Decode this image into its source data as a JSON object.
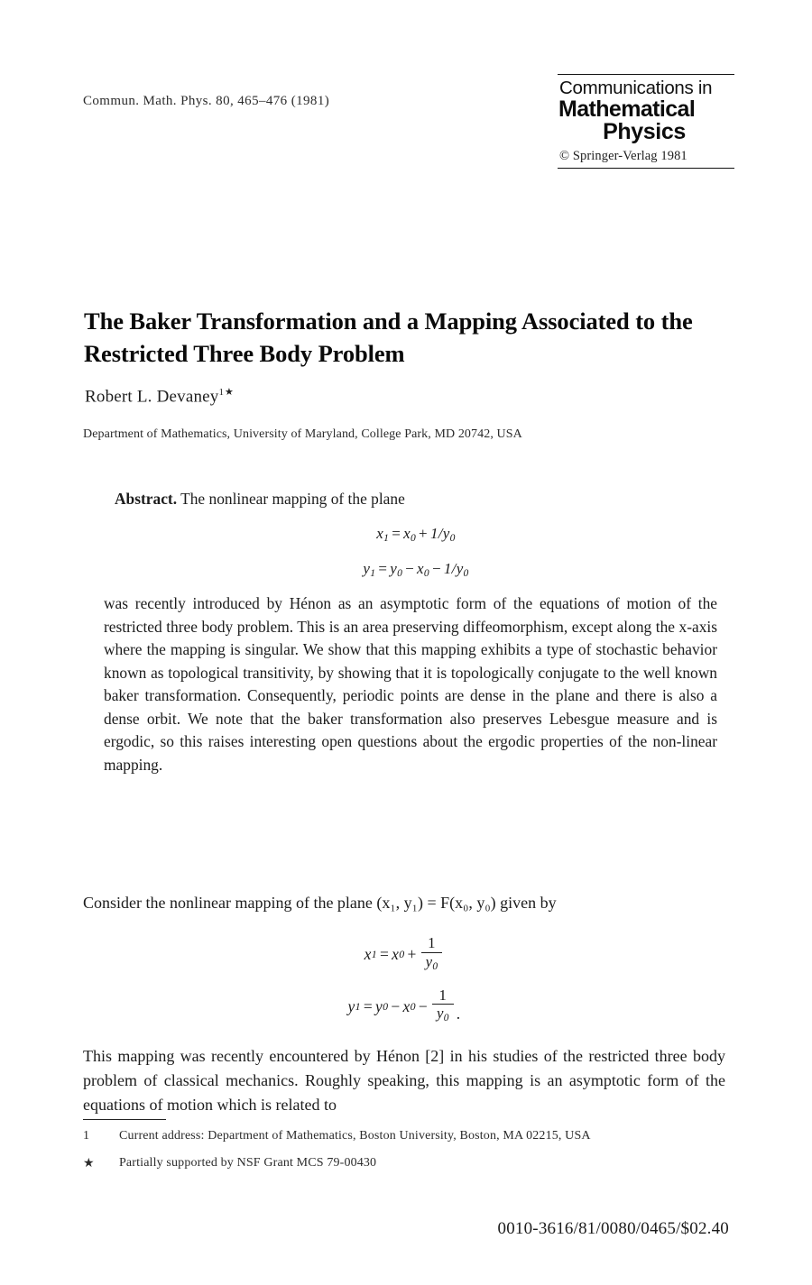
{
  "header": {
    "journal_reference": "Commun. Math. Phys. 80, 465–476 (1981)",
    "masthead": {
      "line1": "Communications in",
      "line2": "Mathematical",
      "line3": "Physics",
      "copyright": "© Springer-Verlag 1981"
    }
  },
  "article": {
    "title": "The Baker Transformation and a Mapping Associated to the Restricted Three Body Problem",
    "author": "Robert L. Devaney",
    "author_markers": "1★",
    "affiliation": "Department of Mathematics, University of Maryland, College Park, MD 20742, USA"
  },
  "abstract": {
    "label": "Abstract.",
    "intro": "The nonlinear mapping of the plane",
    "equations": [
      {
        "lhs": "x",
        "lhs_sub": "1",
        "rhs": "x₀ + 1/y₀"
      },
      {
        "lhs": "y",
        "lhs_sub": "1",
        "rhs": "y₀ − x₀ − 1/y₀"
      }
    ],
    "body": "was recently introduced by Hénon as an asymptotic form of the equations of motion of the restricted three body problem. This is an area preserving diffeomorphism, except along the x-axis where the mapping is singular. We show that this mapping exhibits a type of stochastic behavior known as topological transitivity, by showing that it is topologically conjugate to the well known baker transformation. Consequently, periodic points are dense in the plane and there is also a dense orbit. We note that the baker transformation also preserves Lebesgue measure and is ergodic, so this raises interesting open questions about the ergodic properties of the non-linear mapping."
  },
  "body": {
    "paragraph_1": "Consider the nonlinear mapping of the plane (x₁, y₁) = F(x₀, y₀) given by",
    "paragraph_2": "This mapping was recently encountered by Hénon [2] in his studies of the restricted three body problem of classical mechanics. Roughly speaking, this mapping is an asymptotic form of the equations of motion which is related to"
  },
  "footnotes": [
    {
      "marker": "1",
      "text": "Current address: Department of Mathematics, Boston University, Boston, MA 02215, USA"
    },
    {
      "marker": "★",
      "text": "Partially supported by NSF Grant MCS 79-00430"
    }
  ],
  "footer": {
    "issn_line": "0010-3616/81/0080/0465/$02.40"
  }
}
